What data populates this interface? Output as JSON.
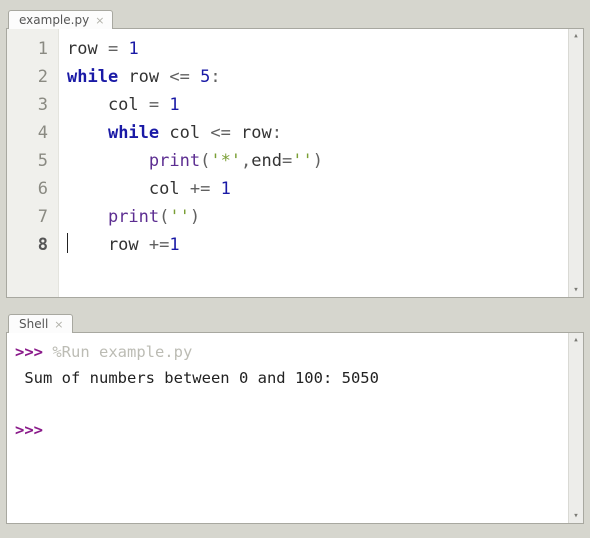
{
  "editor": {
    "tab_label": "example.py",
    "current_line": 8,
    "lines": [
      {
        "n": 1,
        "tokens": [
          [
            "",
            "row "
          ],
          [
            "op",
            "="
          ],
          [
            "",
            " "
          ],
          [
            "num",
            "1"
          ]
        ]
      },
      {
        "n": 2,
        "tokens": [
          [
            "kw",
            "while"
          ],
          [
            "",
            " row "
          ],
          [
            "op",
            "<="
          ],
          [
            "",
            " "
          ],
          [
            "num",
            "5"
          ],
          [
            "op",
            ":"
          ]
        ]
      },
      {
        "n": 3,
        "tokens": [
          [
            "",
            "    col "
          ],
          [
            "op",
            "="
          ],
          [
            "",
            " "
          ],
          [
            "num",
            "1"
          ]
        ]
      },
      {
        "n": 4,
        "tokens": [
          [
            "",
            "    "
          ],
          [
            "kw",
            "while"
          ],
          [
            "",
            " col "
          ],
          [
            "op",
            "<="
          ],
          [
            "",
            " row"
          ],
          [
            "op",
            ":"
          ]
        ]
      },
      {
        "n": 5,
        "tokens": [
          [
            "",
            "        "
          ],
          [
            "bfn",
            "print"
          ],
          [
            "op",
            "("
          ],
          [
            "str",
            "'*'"
          ],
          [
            "op",
            ","
          ],
          [
            "",
            "end"
          ],
          [
            "op",
            "="
          ],
          [
            "str",
            "''"
          ],
          [
            "op",
            ")"
          ]
        ]
      },
      {
        "n": 6,
        "tokens": [
          [
            "",
            "        col "
          ],
          [
            "op",
            "+="
          ],
          [
            "",
            " "
          ],
          [
            "num",
            "1"
          ]
        ]
      },
      {
        "n": 7,
        "tokens": [
          [
            "",
            "    "
          ],
          [
            "bfn",
            "print"
          ],
          [
            "op",
            "("
          ],
          [
            "str",
            "''"
          ],
          [
            "op",
            ")"
          ]
        ]
      },
      {
        "n": 8,
        "tokens": [
          [
            "",
            "    row "
          ],
          [
            "op",
            "+="
          ],
          [
            "num",
            "1"
          ]
        ]
      }
    ]
  },
  "shell": {
    "tab_label": "Shell",
    "prompt": ">>>",
    "run_command": "%Run example.py",
    "output": " Sum of numbers between 0 and 100: 5050"
  }
}
